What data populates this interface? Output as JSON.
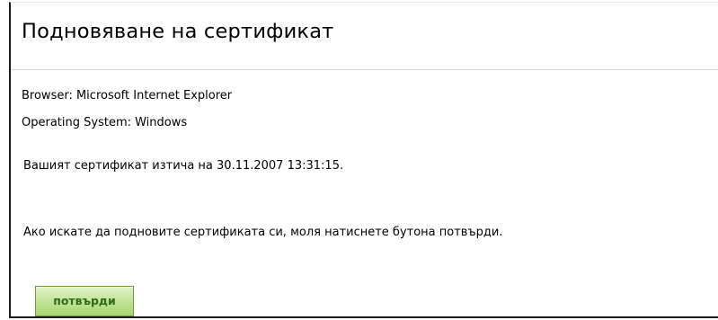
{
  "page": {
    "title": "Подновяване на сертификат"
  },
  "info": {
    "browser": "Browser: Microsoft Internet Explorer",
    "os": "Operating System: Windows"
  },
  "message": {
    "expiry": "Вашият сертификат изтича на 30.11.2007 13:31:15.",
    "instruction": "Ако искате да подновите сертификата си, моля натиснете бутона потвърди."
  },
  "actions": {
    "confirm_label": "потвърди"
  },
  "colors": {
    "button_text": "#2f6b1a",
    "button_fill": "#c5e59b",
    "button_border": "#6f9a3e"
  }
}
